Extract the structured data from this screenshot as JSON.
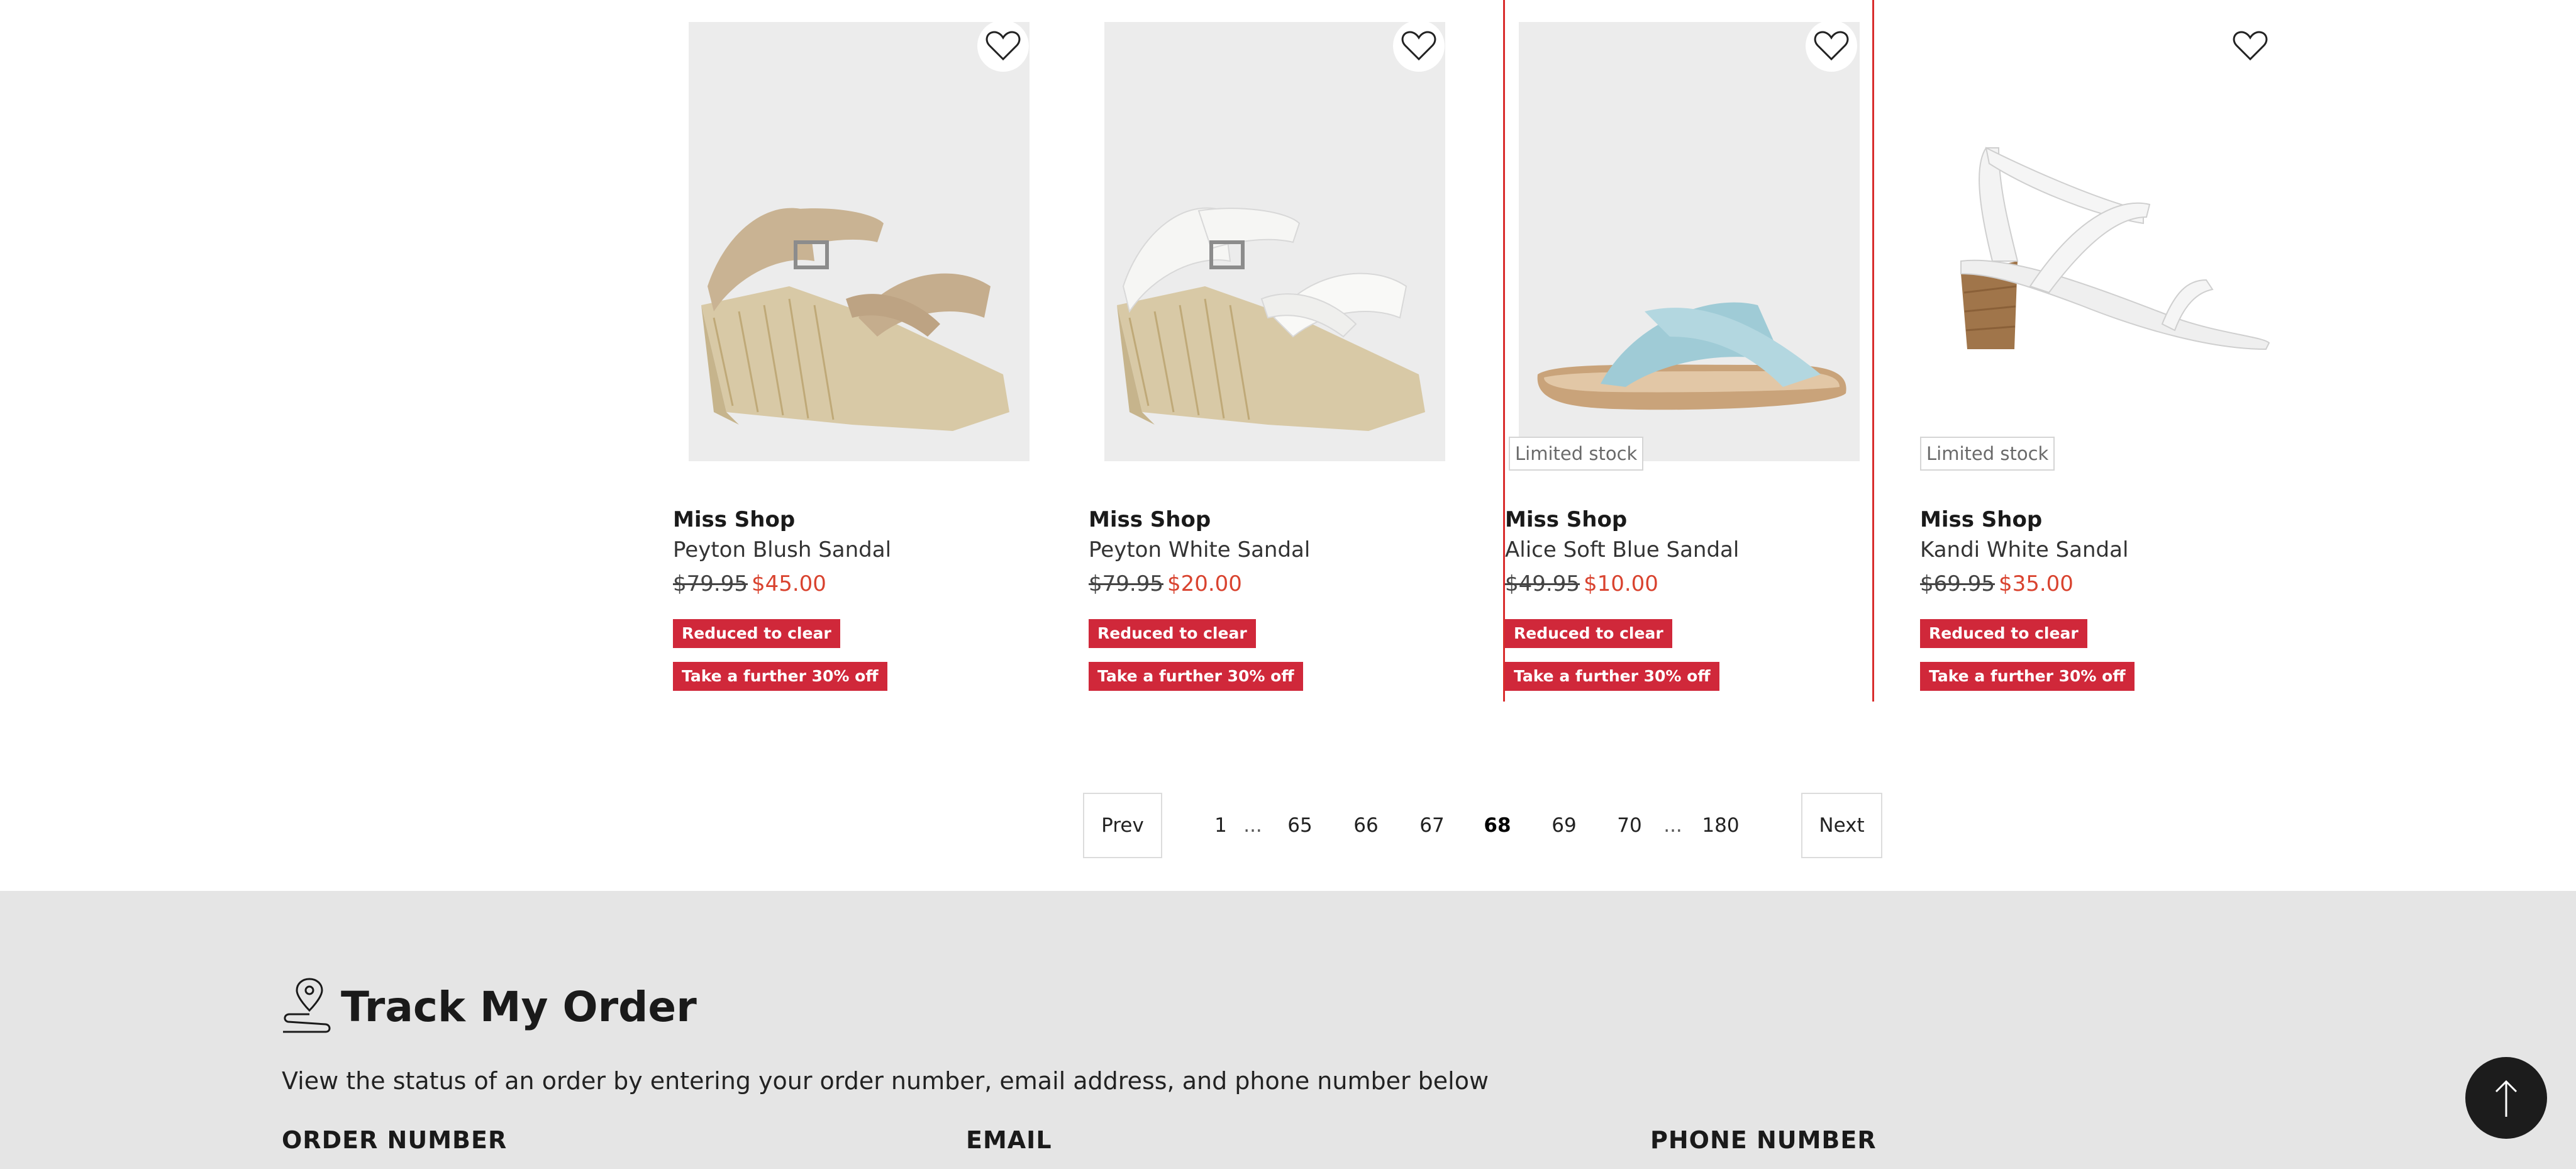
{
  "products": [
    {
      "brand": "Miss Shop",
      "name": "Peyton Blush Sandal",
      "was_price": "$79.95",
      "now_price": "$45.00",
      "limited": "",
      "badges": [
        "Reduced to clear",
        "Take a further 30% off"
      ],
      "image_icon": "wedge-sandal-blush"
    },
    {
      "brand": "Miss Shop",
      "name": "Peyton White Sandal",
      "was_price": "$79.95",
      "now_price": "$20.00",
      "limited": "",
      "badges": [
        "Reduced to clear",
        "Take a further 30% off"
      ],
      "image_icon": "wedge-sandal-white"
    },
    {
      "brand": "Miss Shop",
      "name": "Alice Soft Blue Sandal",
      "was_price": "$49.95",
      "now_price": "$10.00",
      "limited": "Limited stock",
      "badges": [
        "Reduced to clear",
        "Take a further 30% off"
      ],
      "image_icon": "slide-sandal-blue"
    },
    {
      "brand": "Miss Shop",
      "name": "Kandi White Sandal",
      "was_price": "$69.95",
      "now_price": "$35.00",
      "limited": "Limited stock",
      "badges": [
        "Reduced to clear",
        "Take a further 30% off"
      ],
      "image_icon": "block-heel-sandal-white"
    }
  ],
  "pagination": {
    "prev": "Prev",
    "next": "Next",
    "pages": [
      "1",
      "65",
      "66",
      "67",
      "68",
      "69",
      "70",
      "180"
    ],
    "ellipsis": "...",
    "current": "68"
  },
  "track_order": {
    "title": "Track My Order",
    "description": "View the status of an order by entering your order number, email address, and phone number below",
    "fields": [
      "ORDER NUMBER",
      "EMAIL",
      "PHONE NUMBER"
    ],
    "icon": "location-pin-route-icon"
  },
  "colors": {
    "sale_price": "#d9432f",
    "badge": "#d0283a",
    "selection_outline": "#d92d2d",
    "footer_bg": "#e5e5e5"
  }
}
